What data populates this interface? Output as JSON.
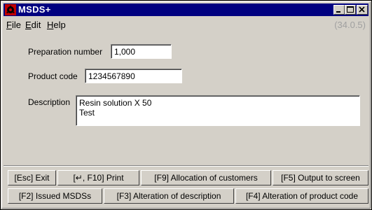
{
  "window": {
    "title": "MSDS+",
    "minimize_icon": "minimize-icon",
    "maximize_icon": "maximize-icon",
    "close_icon": "close-icon",
    "app_icon": "msds-hazard-icon",
    "title_color": "#000080"
  },
  "menu": {
    "file": "File",
    "edit": "Edit",
    "help": "Help",
    "version": "(34.0.5)"
  },
  "form": {
    "preparation_label": "Preparation number",
    "preparation_value": "1,000",
    "product_code_label": "Product code",
    "product_code_value": "1234567890",
    "description_label": "Description",
    "description_lines": [
      "Resin solution  X 50",
      "Test"
    ]
  },
  "buttons": {
    "row1": [
      "[Esc] Exit",
      "[↵, F10] Print",
      "[F9] Allocation of customers",
      "[F5] Output to screen"
    ],
    "row2": [
      "[F2] Issued MSDSs",
      "[F3] Alteration of description",
      "[F4] Alteration of product code"
    ]
  }
}
